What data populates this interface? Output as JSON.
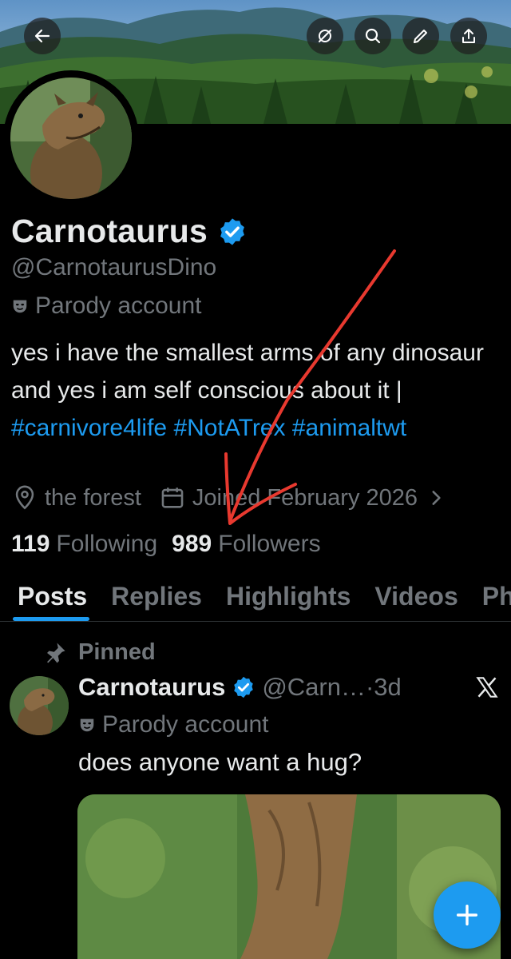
{
  "header": {
    "back_icon": "arrow-left-icon",
    "actions": [
      "eye-off-icon",
      "search-icon",
      "pencil-icon",
      "share-icon"
    ]
  },
  "profile": {
    "name": "Carnotaurus",
    "handle": "@CarnotaurusDino",
    "parody_label": "Parody account",
    "bio_text": "yes i have the smallest arms of any dinosaur and yes i am self conscious about it | ",
    "bio_tags": [
      "#carnivore4life",
      "#NotATrex",
      "#animaltwt"
    ],
    "location": "the forest",
    "joined": "Joined February 2026",
    "following_count": "119",
    "following_label": "Following",
    "followers_count": "989",
    "followers_label": "Followers"
  },
  "tabs": [
    {
      "label": "Posts",
      "active": true
    },
    {
      "label": "Replies",
      "active": false
    },
    {
      "label": "Highlights",
      "active": false
    },
    {
      "label": "Videos",
      "active": false
    },
    {
      "label": "Photos",
      "active": false
    }
  ],
  "post": {
    "pinned_label": "Pinned",
    "author_name": "Carnotaurus",
    "author_handle": "@Carn…",
    "time": "·3d",
    "parody_label": "Parody account",
    "text": "does anyone want a hug?"
  },
  "colors": {
    "accent": "#1d9bf0",
    "muted": "#71767b",
    "text": "#e7e9ea",
    "annotation": "#e8392f"
  }
}
